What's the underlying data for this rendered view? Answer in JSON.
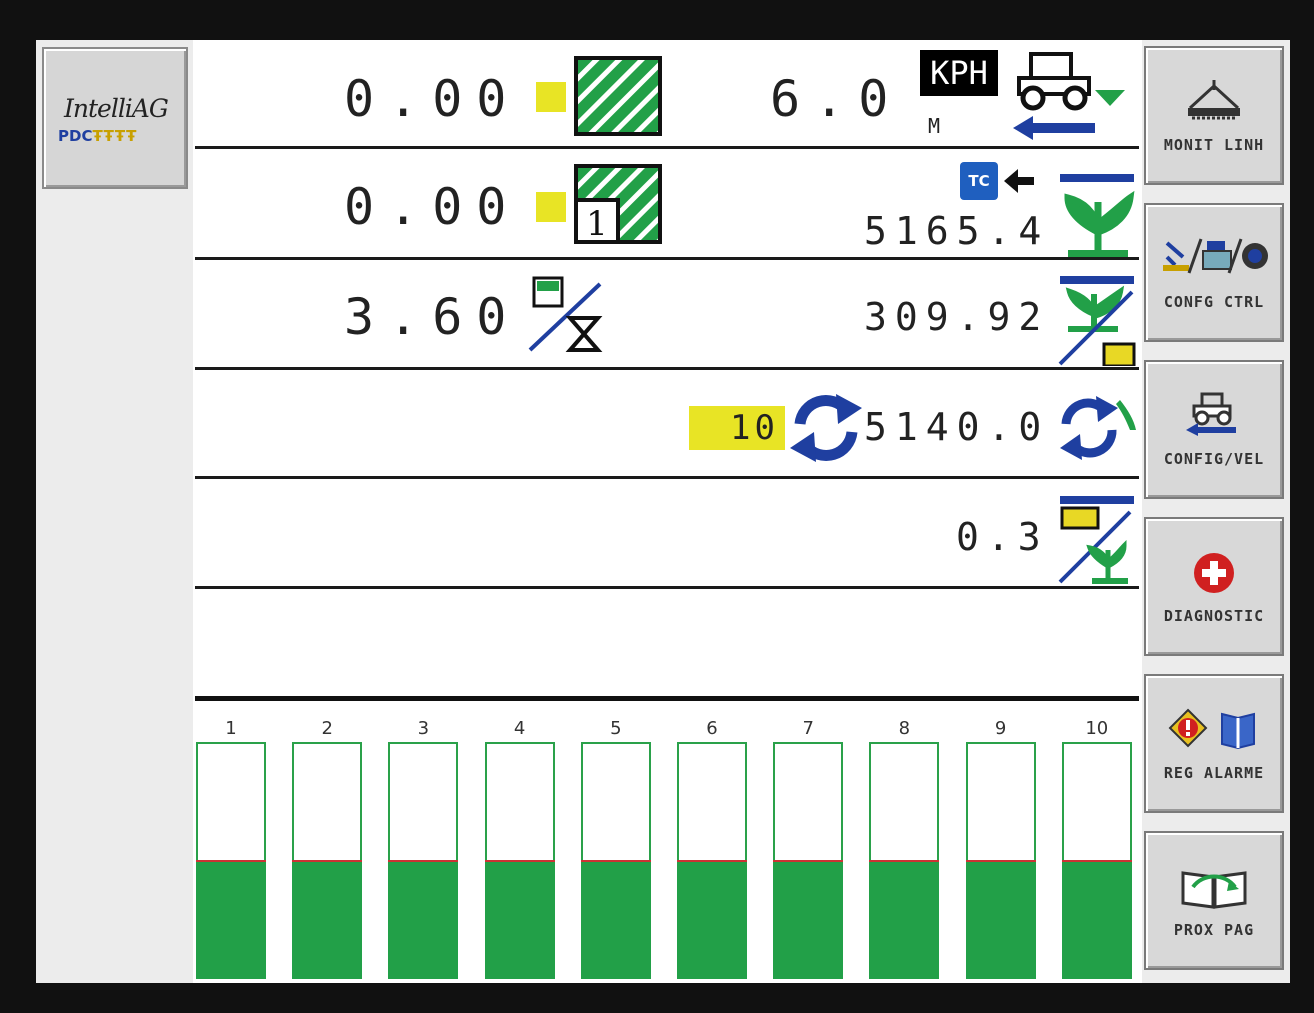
{
  "logo": {
    "brand": "IntelliAG",
    "product": "PDC",
    "nozzles": "ŦŦŦŦ"
  },
  "rows": {
    "row1": {
      "left_value": "0.00",
      "speed_value": "6.0",
      "speed_unit": "KPH",
      "sub_unit": "M"
    },
    "row2": {
      "left_value": "0.00",
      "right_value": "5165.4",
      "subarea_index": "1",
      "tc_badge": "TC"
    },
    "row3": {
      "left_value": "3.60",
      "right_value": "309.92"
    },
    "row4": {
      "counter": "10",
      "right_value": "5140.0"
    },
    "row5": {
      "right_value": "0.3"
    }
  },
  "softkeys": [
    {
      "label": "MONIT LINH",
      "icon": "planter-row-icon"
    },
    {
      "label": "CONFG CTRL",
      "icon": "config-control-icon"
    },
    {
      "label": "CONFIG/VEL",
      "icon": "tractor-speed-icon"
    },
    {
      "label": "DIAGNOSTIC",
      "icon": "diagnostic-cross-icon"
    },
    {
      "label": "REG ALARME",
      "icon": "alarm-log-icon"
    },
    {
      "label": "PROX PAG",
      "icon": "next-page-book-icon"
    }
  ],
  "sections": [
    {
      "label": "1",
      "level": 0.5
    },
    {
      "label": "2",
      "level": 0.5
    },
    {
      "label": "3",
      "level": 0.5
    },
    {
      "label": "4",
      "level": 0.5
    },
    {
      "label": "5",
      "level": 0.5
    },
    {
      "label": "6",
      "level": 0.5
    },
    {
      "label": "7",
      "level": 0.5
    },
    {
      "label": "8",
      "level": 0.5
    },
    {
      "label": "9",
      "level": 0.5
    },
    {
      "label": "10",
      "level": 0.5
    }
  ],
  "colors": {
    "green": "#22a048",
    "yellow": "#e8e425",
    "blue": "#1f3fa0",
    "alert_red": "#d02020"
  }
}
